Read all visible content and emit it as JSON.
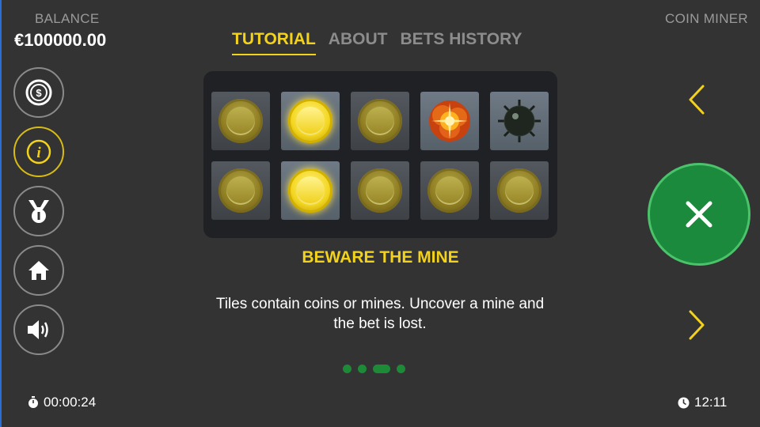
{
  "header": {
    "balance_label": "BALANCE",
    "balance_value": "€100000.00",
    "game_title": "COIN MINER"
  },
  "tabs": [
    {
      "label": "TUTORIAL",
      "active": true
    },
    {
      "label": "ABOUT",
      "active": false
    },
    {
      "label": "BETS HISTORY",
      "active": false
    }
  ],
  "sidebar": {
    "buttons": [
      {
        "icon": "dollar-coin-icon"
      },
      {
        "icon": "info-icon",
        "active": true
      },
      {
        "icon": "medal-icon"
      },
      {
        "icon": "home-icon"
      },
      {
        "icon": "speaker-icon"
      }
    ]
  },
  "board": {
    "rows": [
      [
        "coin",
        "coin-bright",
        "coin",
        "explosion",
        "mine"
      ],
      [
        "coin",
        "coin-bright",
        "coin",
        "coin",
        "coin"
      ]
    ]
  },
  "tutorial": {
    "title": "BEWARE THE MINE",
    "description": "Tiles contain coins or mines. Uncover a mine and the bet is lost.",
    "page_count": 4,
    "current_page": 3
  },
  "controls": {
    "prev_icon": "chevron-left-icon",
    "next_icon": "chevron-right-icon",
    "close_icon": "close-icon"
  },
  "footer": {
    "session_time": "00:00:24",
    "clock": "12:11"
  },
  "colors": {
    "background": "#333333",
    "accent_yellow": "#f2d21b",
    "close_green": "#1b8a3c",
    "dot_green": "#1d8a38"
  }
}
